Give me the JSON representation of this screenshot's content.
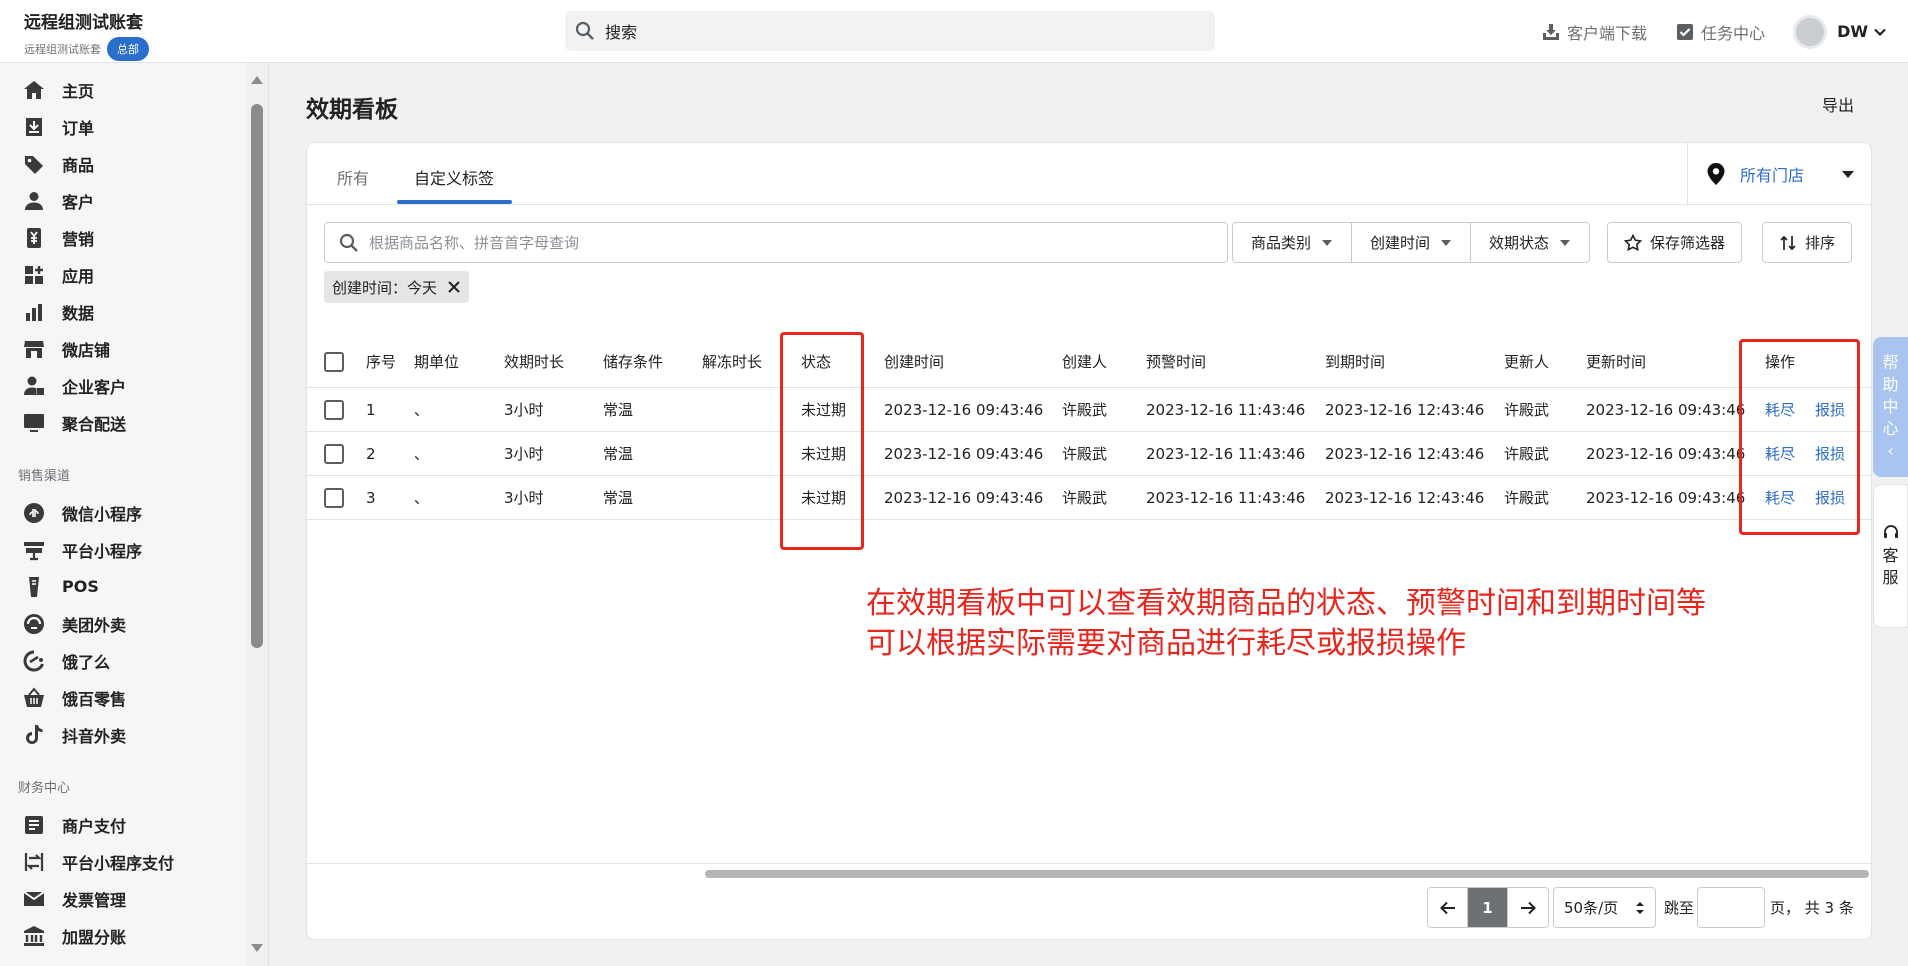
{
  "header": {
    "account_name": "远程组测试账套",
    "account_sub": "远程组测试账套",
    "badge": "总部",
    "search_placeholder": "搜索",
    "client_download": "客户端下载",
    "task_center": "任务中心",
    "user": "DW"
  },
  "sidebar": {
    "main": [
      {
        "label": "主页",
        "icon": "home-icon"
      },
      {
        "label": "订单",
        "icon": "order-icon"
      },
      {
        "label": "商品",
        "icon": "tag-icon"
      },
      {
        "label": "客户",
        "icon": "person-icon"
      },
      {
        "label": "营销",
        "icon": "yen-icon"
      },
      {
        "label": "应用",
        "icon": "apps-icon"
      },
      {
        "label": "数据",
        "icon": "chart-icon"
      },
      {
        "label": "微店铺",
        "icon": "store-icon"
      },
      {
        "label": "企业客户",
        "icon": "enterprise-icon"
      },
      {
        "label": "聚合配送",
        "icon": "monitor-icon"
      }
    ],
    "sales_title": "销售渠道",
    "sales": [
      {
        "label": "微信小程序",
        "icon": "wechat-icon"
      },
      {
        "label": "平台小程序",
        "icon": "platform-icon"
      },
      {
        "label": "POS",
        "icon": "pos-icon"
      },
      {
        "label": "美团外卖",
        "icon": "meituan-icon"
      },
      {
        "label": "饿了么",
        "icon": "eleme-icon"
      },
      {
        "label": "饿百零售",
        "icon": "basket-icon"
      },
      {
        "label": "抖音外卖",
        "icon": "tiktok-icon"
      }
    ],
    "finance_title": "财务中心",
    "finance": [
      {
        "label": "商户支付",
        "icon": "doc-icon"
      },
      {
        "label": "平台小程序支付",
        "icon": "transfer-icon"
      },
      {
        "label": "发票管理",
        "icon": "invoice-icon"
      },
      {
        "label": "加盟分账",
        "icon": "bank-icon"
      }
    ]
  },
  "page": {
    "title": "效期看板",
    "export": "导出",
    "tabs": [
      "所有",
      "自定义标签"
    ],
    "store_filter": "所有门店",
    "search_placeholder": "根据商品名称、拼音首字母查询",
    "filters": [
      "商品类别",
      "创建时间",
      "效期状态"
    ],
    "save_filter": "保存筛选器",
    "sort": "排序",
    "chip": "创建时间：今天"
  },
  "table": {
    "headers": [
      "序号",
      "期单位",
      "效期时长",
      "储存条件",
      "解冻时长",
      "状态",
      "创建时间",
      "创建人",
      "预警时间",
      "到期时间",
      "更新人",
      "更新时间",
      "操作"
    ],
    "rows": [
      {
        "no": "1",
        "unit": "、",
        "duration": "3小时",
        "storage": "常温",
        "thaw": "",
        "status": "未过期",
        "created": "2023-12-16 09:43:46",
        "creator": "许殿武",
        "warn": "2023-12-16 11:43:46",
        "expire": "2023-12-16 12:43:46",
        "updater": "许殿武",
        "updated": "2023-12-16 09:43:46",
        "act1": "耗尽",
        "act2": "报损"
      },
      {
        "no": "2",
        "unit": "、",
        "duration": "3小时",
        "storage": "常温",
        "thaw": "",
        "status": "未过期",
        "created": "2023-12-16 09:43:46",
        "creator": "许殿武",
        "warn": "2023-12-16 11:43:46",
        "expire": "2023-12-16 12:43:46",
        "updater": "许殿武",
        "updated": "2023-12-16 09:43:46",
        "act1": "耗尽",
        "act2": "报损"
      },
      {
        "no": "3",
        "unit": "、",
        "duration": "3小时",
        "storage": "常温",
        "thaw": "",
        "status": "未过期",
        "created": "2023-12-16 09:43:46",
        "creator": "许殿武",
        "warn": "2023-12-16 11:43:46",
        "expire": "2023-12-16 12:43:46",
        "updater": "许殿武",
        "updated": "2023-12-16 09:43:46",
        "act1": "耗尽",
        "act2": "报损"
      }
    ]
  },
  "pagination": {
    "current": "1",
    "page_size": "50条/页",
    "jump_label": "跳至",
    "total": "页， 共 3 条"
  },
  "annotation": {
    "line1": "在效期看板中可以查看效期商品的状态、预警时间和到期时间等",
    "line2": "可以根据实际需要对商品进行耗尽或报损操作"
  },
  "widgets": {
    "help": [
      "帮",
      "助",
      "中",
      "心",
      "‹"
    ],
    "service": [
      "客",
      "服"
    ]
  },
  "colors": {
    "accent": "#2c6ecb",
    "annotation": "#e8261e"
  }
}
